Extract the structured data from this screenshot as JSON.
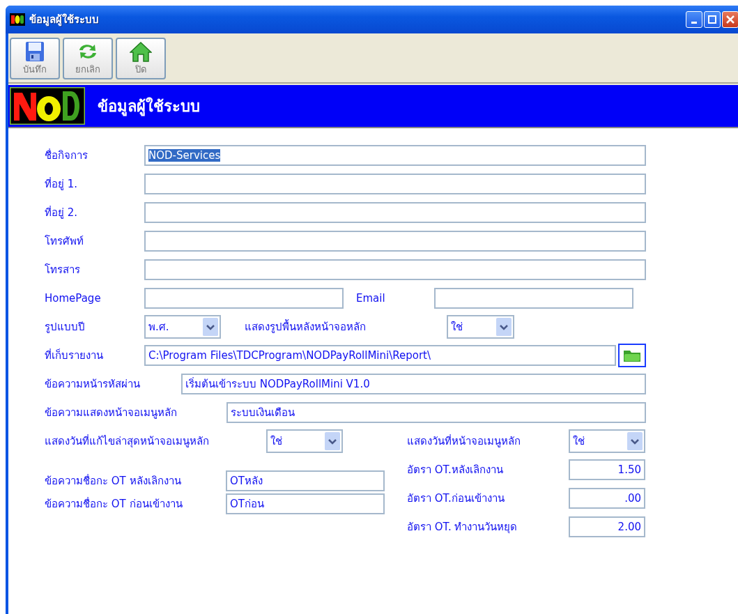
{
  "window": {
    "title": "ข้อมูลผู้ใช้ระบบ"
  },
  "toolbar": [
    {
      "label": "บันทึก",
      "kind": "save"
    },
    {
      "label": "ยกเลิก",
      "kind": "refresh"
    },
    {
      "label": "ปิด",
      "kind": "home"
    }
  ],
  "header": {
    "title": "ข้อมูลผู้ใช้ระบบ"
  },
  "form": {
    "company": {
      "label": "ชื่อกิจการ",
      "value": "NOD-Services",
      "highlighted": true
    },
    "address_1": {
      "label": "ที่อยู่ 1."
    },
    "address_2": {
      "label": "ที่อยู่ 2."
    },
    "phone": {
      "label": "โทรศัพท์"
    },
    "fax": {
      "label": "โทรสาร"
    },
    "homepage": {
      "label": "HomePage"
    },
    "email": {
      "label": "Email"
    },
    "year_format": {
      "label": "รูปแบบปี",
      "value": "พ.ศ."
    },
    "show_background": {
      "label": "แสดงรูปพื้นหลังหน้าจอหลัก",
      "value": "ใช่"
    },
    "report_folder": {
      "label": "ที่เก็บรายงาน",
      "value": "C:\\Program Files\\TDCProgram\\NODPayRollMini\\Report\\"
    },
    "password_message": {
      "label": "ข้อความหน้ารหัสผ่าน",
      "value": "เริ่มต้นเข้าระบบ NODPayRollMini V1.0"
    },
    "menu_message": {
      "label": "ข้อความแสดงหน้าจอเมนูหลัก",
      "value": "ระบบเงินเดือน"
    },
    "show_last_edit_date": {
      "label": "แสดงวันที่แก้ไขล่าสุดหน้าจอเมนูหลัก",
      "value": "ใช่"
    },
    "show_date": {
      "label": "แสดงวันที่หน้าจอเมนูหลัก",
      "value": "ใช่"
    },
    "ot_after_rate": {
      "label": "อัตรา OT.หลังเลิกงาน",
      "value": "1.50"
    },
    "ot_after_name": {
      "label": "ข้อความชื่อกะ OT หลังเลิกงาน",
      "value": "OTหลัง"
    },
    "ot_before_rate": {
      "label": "อัตรา OT.ก่อนเข้างาน",
      "value": ".00"
    },
    "ot_before_name": {
      "label": "ข้อความชื่อกะ OT ก่อนเข้างาน",
      "value": "OTก่อน"
    },
    "ot_holiday_rate": {
      "label": "อัตรา OT. ทำงานวันหยุด",
      "value": "2.00"
    }
  }
}
